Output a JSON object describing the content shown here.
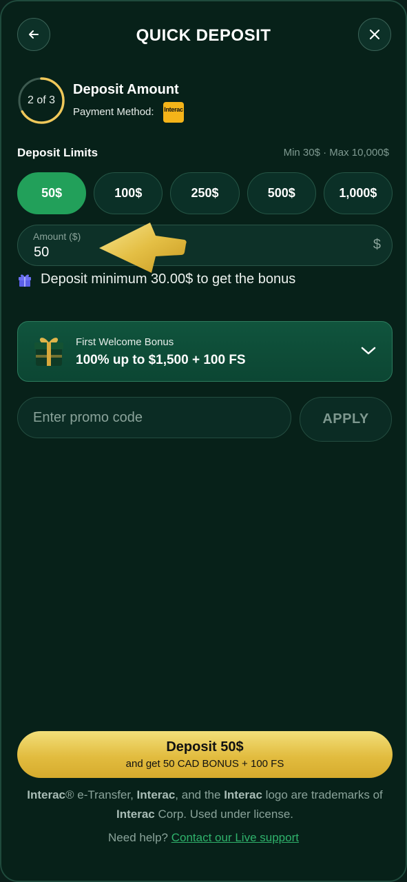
{
  "header": {
    "title": "QUICK DEPOSIT",
    "back_icon": "arrow-left-icon",
    "close_icon": "close-icon"
  },
  "step": {
    "label": "2 of 3",
    "progress": 0.6667,
    "title": "Deposit Amount",
    "payment_method_label": "Payment Method:",
    "payment_logo_text": "Interac"
  },
  "limits": {
    "title": "Deposit Limits",
    "range": "Min 30$ · Max 10,000$"
  },
  "amounts": [
    {
      "label": "50$",
      "selected": true
    },
    {
      "label": "100$",
      "selected": false
    },
    {
      "label": "250$",
      "selected": false
    },
    {
      "label": "500$",
      "selected": false
    },
    {
      "label": "1,000$",
      "selected": false
    }
  ],
  "amount_field": {
    "label": "Amount ($)",
    "value": "50",
    "unit": "$"
  },
  "bonus_note": "Deposit minimum 30.00$ to get the bonus",
  "bonus_card": {
    "small": "First Welcome Bonus",
    "big": "100% up to $1,500 + 100 FS"
  },
  "promo": {
    "placeholder": "Enter promo code",
    "apply_label": "APPLY"
  },
  "deposit": {
    "main": "Deposit 50$",
    "sub": "and get 50 CAD BONUS + 100 FS"
  },
  "legal": {
    "p1": "Interac",
    "p2": "® e-Transfer, ",
    "p3": "Interac",
    "p4": ", and the ",
    "p5": "Interac",
    "p6": " logo are trademarks of ",
    "p7": "Interac",
    "p8": " Corp. Used under license."
  },
  "help": {
    "prefix": "Need help?",
    "link": "Contact our Live support"
  },
  "colors": {
    "background": "#072119",
    "accent_green": "#22a05a",
    "gold": "#e2bc3f",
    "link": "#2fb36c"
  }
}
